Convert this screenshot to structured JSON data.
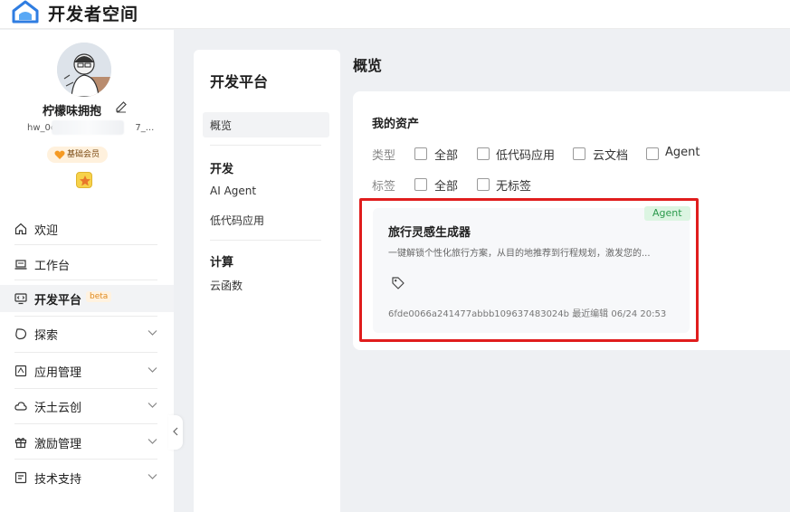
{
  "app": {
    "title": "开发者空间"
  },
  "user": {
    "name": "柠檬味拥抱",
    "id": "hw_0c",
    "id_tail": "7_...",
    "membership": "基础会员"
  },
  "sidebar": {
    "items": [
      {
        "label": "欢迎",
        "icon": "home-icon"
      },
      {
        "label": "工作台",
        "icon": "laptop-icon"
      },
      {
        "label": "开发平台",
        "icon": "monitor-code-icon",
        "badge": "beta",
        "active": true
      },
      {
        "label": "探索",
        "icon": "explore-icon"
      },
      {
        "label": "应用管理",
        "icon": "app-manage-icon"
      },
      {
        "label": "沃土云创",
        "icon": "cloud-icon"
      },
      {
        "label": "激励管理",
        "icon": "gift-icon"
      },
      {
        "label": "技术支持",
        "icon": "support-icon"
      }
    ]
  },
  "subnav": {
    "title": "开发平台",
    "overview": "概览",
    "sections": [
      {
        "title": "开发",
        "items": [
          "AI Agent",
          "低代码应用"
        ]
      },
      {
        "title": "计算",
        "items": [
          "云函数"
        ]
      }
    ]
  },
  "main": {
    "page_title": "概览",
    "panel_title": "我的资产",
    "filters": {
      "type_label": "类型",
      "type_options": [
        "全部",
        "低代码应用",
        "云文档",
        "Agent"
      ],
      "tag_label": "标签",
      "tag_options": [
        "全部",
        "无标签"
      ]
    },
    "card": {
      "badge": "Agent",
      "title": "旅行灵感生成器",
      "description": "一键解锁个性化旅行方案，从目的地推荐到行程规划，激发您的...",
      "id": "6fde0066a241477abbb109637483024b",
      "edited_label": "最近编辑",
      "edited_time": "06/24 20:53"
    }
  },
  "colors": {
    "accent": "#e01d1d",
    "agent_badge": "#2b9a4c",
    "beta": "#e08a1e"
  }
}
